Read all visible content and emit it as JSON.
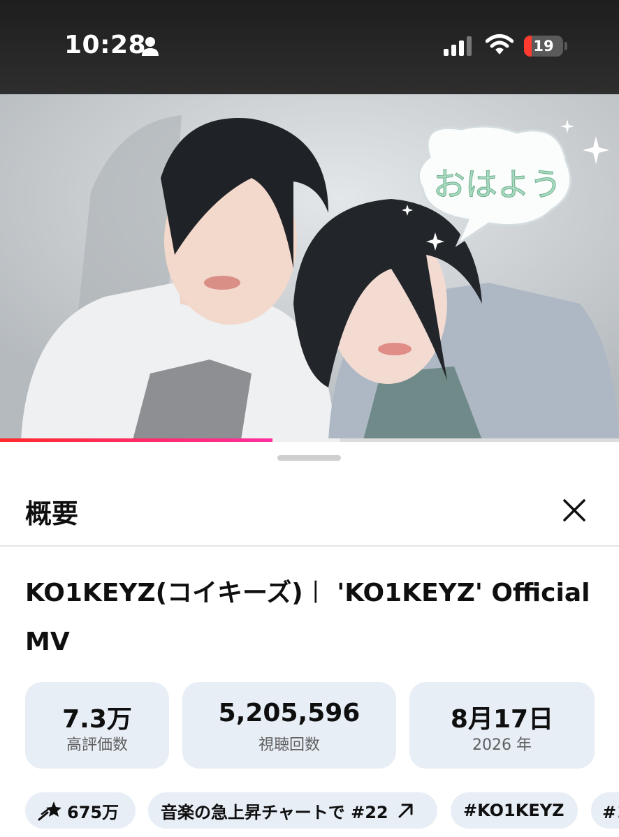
{
  "status_bar": {
    "time": "10:28",
    "battery_level": "19",
    "battery_fraction": 0.19
  },
  "video": {
    "overlay_text": "おはよう",
    "progress_played_fraction": 0.44,
    "progress_buffered_fraction": 0.55
  },
  "sheet": {
    "title": "概要",
    "video_title": "KO1KEYZ(コイキーズ)︱ 'KO1KEYZ' Official MV"
  },
  "stats": [
    {
      "value": "7.3万",
      "label": "高評価数"
    },
    {
      "value": "5,205,596",
      "label": "視聴回数"
    },
    {
      "value": "8月17日",
      "label": "2026 年"
    }
  ],
  "chips": [
    {
      "label": "675万",
      "icon": "shooting-star-icon"
    },
    {
      "label": "音楽の急上昇チャートで #22",
      "icon": "arrow-up-right-icon"
    },
    {
      "label": "#KO1KEYZ"
    },
    {
      "label": "#コ"
    }
  ],
  "colors": {
    "accent_red": "#ff2a2a",
    "chip_bg": "#e8eef6",
    "bubble_text": "#a9dcc2"
  }
}
